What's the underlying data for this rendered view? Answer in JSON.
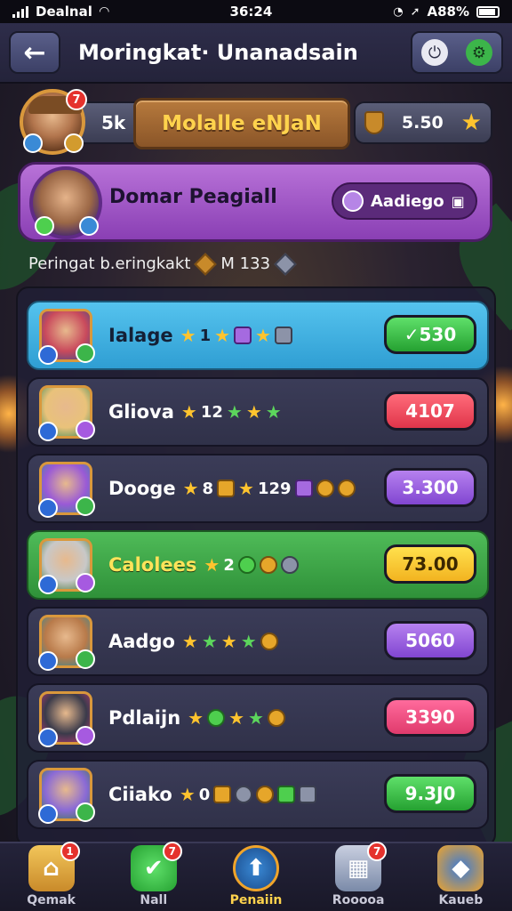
{
  "status_bar": {
    "carrier": "Dealnal",
    "time": "36:24",
    "battery": "A88%"
  },
  "header": {
    "title": "Moringkat·  Unanadsain"
  },
  "top_bar": {
    "notification_count": "7",
    "left_value": "5k",
    "title": "Molalle eNJaN",
    "coins": "5.50"
  },
  "player_card": {
    "name": "Domar Peagiall",
    "pill_label": "Aadiego"
  },
  "subline": {
    "text": "Peringat b.eringkakt",
    "value": "M 133"
  },
  "leaderboard": [
    {
      "name": "Ialage",
      "stat1": "1",
      "stat2": "",
      "score": "✓530",
      "style": "blue",
      "score_color": "green",
      "icons": [
        "star-icon",
        "star-icon",
        "sword-icon",
        "star-icon",
        "tool-icon"
      ]
    },
    {
      "name": "Gliova",
      "stat1": "12",
      "stat2": "",
      "score": "4107",
      "style": "normal",
      "score_color": "red",
      "icons": [
        "star-icon",
        "star-icon",
        "star-icon",
        "star-icon"
      ]
    },
    {
      "name": "Dooge",
      "stat1": "8",
      "stat2": "129",
      "score": "3.300",
      "style": "normal",
      "score_color": "purple",
      "icons": [
        "star-icon",
        "crate-icon",
        "star-icon",
        "sword-icon",
        "coin-icon",
        "coin-icon"
      ]
    },
    {
      "name": "Calolees",
      "stat1": "2",
      "stat2": "",
      "score": "73.00",
      "style": "green",
      "score_color": "yellow",
      "icons": [
        "star-icon",
        "gem-icon",
        "coin-icon",
        "gear-icon"
      ]
    },
    {
      "name": "Aadgo",
      "stat1": "",
      "stat2": "",
      "score": "5060",
      "style": "normal",
      "score_color": "purple",
      "icons": [
        "star-icon",
        "star-icon",
        "star-icon",
        "star-icon",
        "coin-icon"
      ]
    },
    {
      "name": "Pdlaijn",
      "stat1": "",
      "stat2": "",
      "score": "3390",
      "style": "normal",
      "score_color": "pink",
      "icons": [
        "star-icon",
        "gem-icon",
        "star-icon",
        "star-icon",
        "coin-icon"
      ]
    },
    {
      "name": "Ciiako",
      "stat1": "0",
      "stat2": "",
      "score": "9.3J0",
      "style": "normal",
      "score_color": "green",
      "icons": [
        "star-icon",
        "crate-icon",
        "gear-icon",
        "coin-icon",
        "barrel-icon",
        "tool-icon"
      ]
    }
  ],
  "bottom_nav": [
    {
      "label": "Qemak",
      "badge": "1",
      "icon": "house-icon",
      "active": false
    },
    {
      "label": "Nall",
      "badge": "7",
      "icon": "check-icon",
      "active": false
    },
    {
      "label": "Penaiin",
      "badge": "",
      "icon": "rank-icon",
      "active": true
    },
    {
      "label": "Rooooa",
      "badge": "7",
      "icon": "chest-icon",
      "active": false
    },
    {
      "label": "Kaueb",
      "badge": "",
      "icon": "shield-icon",
      "active": false
    }
  ],
  "colors": {
    "accent_gold": "#ffd34d",
    "purple_card": "#a659cc",
    "blue_row": "#3fb0e0",
    "green_row": "#3aa545"
  }
}
